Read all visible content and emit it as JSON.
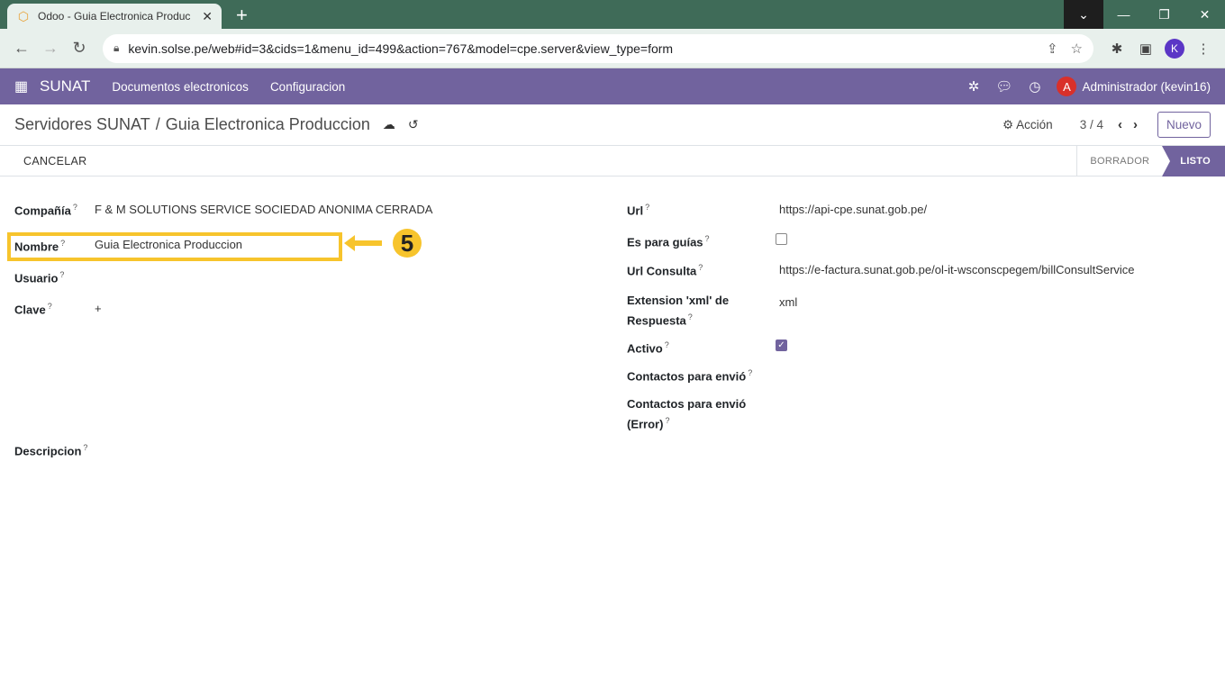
{
  "browser": {
    "tab_title": "Odoo - Guia Electronica Produc",
    "new_tab": "+",
    "url": "kevin.solse.pe/web#id=3&cids=1&menu_id=499&action=767&model=cpe.server&view_type=form",
    "profile_initial": "K"
  },
  "navbar": {
    "brand": "SUNAT",
    "menu": [
      "Documentos electronicos",
      "Configuracion"
    ],
    "avatar_initial": "A",
    "user": "Administrador (kevin16)",
    "color": "#71639e"
  },
  "control": {
    "breadcrumb_parent": "Servidores SUNAT",
    "breadcrumb_sep": "/",
    "breadcrumb_current": "Guia Electronica Produccion",
    "action_label": "Acción",
    "pager": "3 / 4",
    "new_label": "Nuevo"
  },
  "statusbar": {
    "cancel_label": "CANCELAR",
    "states": [
      "BORRADOR",
      "LISTO"
    ],
    "active_state": "LISTO"
  },
  "form": {
    "left": {
      "company_label": "Compañía",
      "company_value": "F & M SOLUTIONS SERVICE SOCIEDAD ANONIMA CERRADA",
      "name_label": "Nombre",
      "name_value": "Guia Electronica Produccion",
      "user_label": "Usuario",
      "password_label": "Clave",
      "password_value": "+",
      "description_label": "Descripcion"
    },
    "right": {
      "url_label": "Url",
      "url_value": "https://api-cpe.sunat.gob.pe/",
      "guides_label": "Es para guías",
      "guides_checked": false,
      "consult_label": "Url Consulta",
      "consult_value": "https://e-factura.sunat.gob.pe/ol-it-wsconscpegem/billConsultService",
      "ext_label_1": "Extension 'xml' de",
      "ext_label_2": "Respuesta",
      "ext_value": "xml",
      "active_label": "Activo",
      "active_checked": true,
      "contacts_label": "Contactos para envió",
      "contacts_error_label_1": "Contactos para envió",
      "contacts_error_label_2": "(Error)"
    },
    "help_marker": "?"
  },
  "annotation": {
    "step": "5",
    "color": "#f7c42c"
  }
}
